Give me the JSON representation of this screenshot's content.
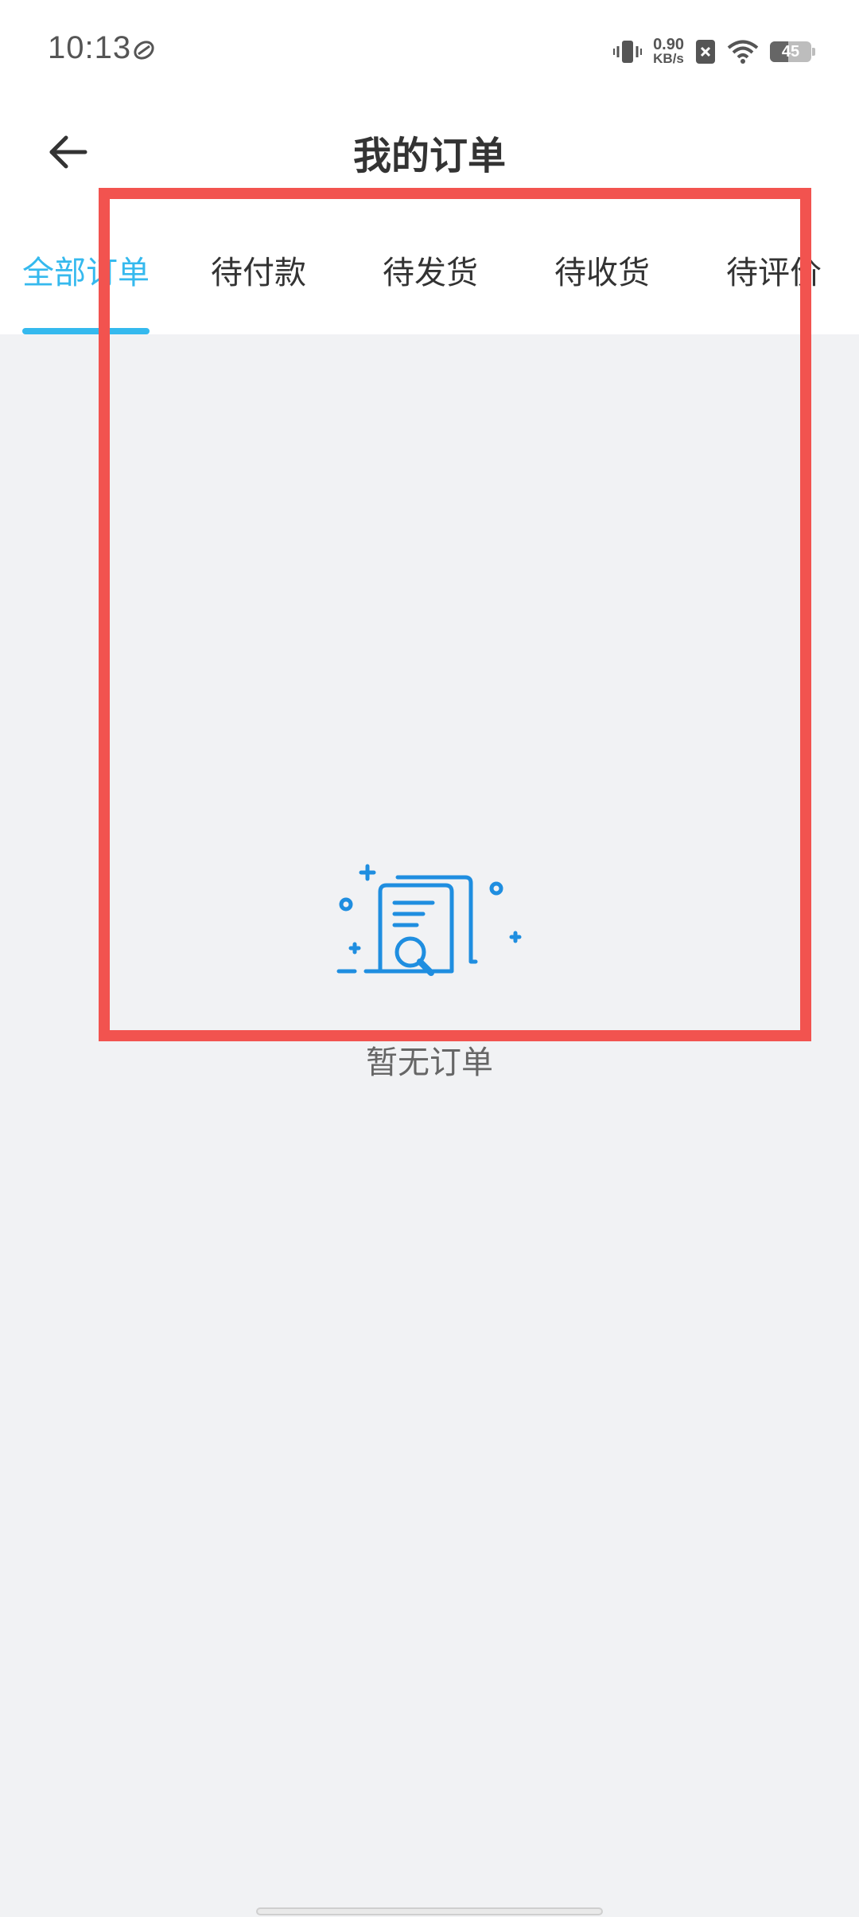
{
  "status_bar": {
    "time": "10:13",
    "net_speed_value": "0.90",
    "net_speed_unit": "KB/s",
    "battery_level": "45",
    "icons": [
      "nfc-icon",
      "vibrate-icon",
      "sim-disabled-icon",
      "wifi-icon",
      "battery-icon"
    ]
  },
  "header": {
    "title": "我的订单",
    "back_icon": "arrow-left-icon"
  },
  "tabs": [
    {
      "label": "全部订单",
      "active": true
    },
    {
      "label": "待付款",
      "active": false
    },
    {
      "label": "待发货",
      "active": false
    },
    {
      "label": "待收货",
      "active": false
    },
    {
      "label": "待评价",
      "active": false
    }
  ],
  "empty_state": {
    "icon": "document-search-icon",
    "message": "暂无订单"
  },
  "colors": {
    "accent": "#35b9ee",
    "highlight": "#f2534f",
    "background": "#f1f2f4",
    "illustration": "#1f8ee0"
  }
}
